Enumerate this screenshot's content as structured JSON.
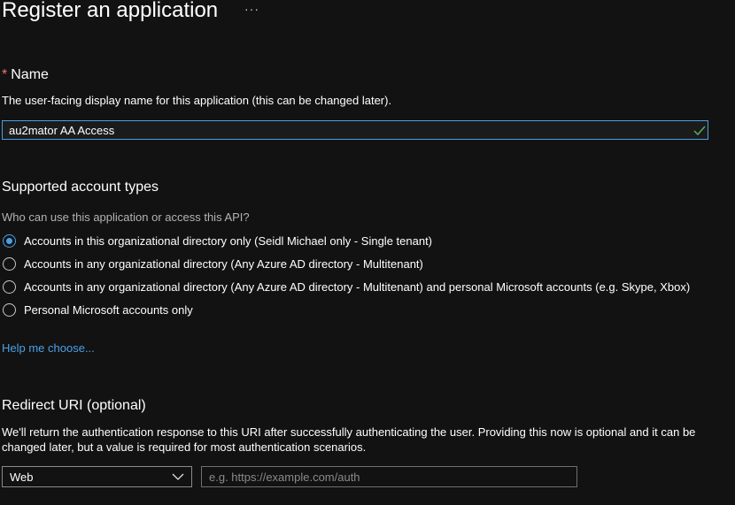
{
  "header": {
    "title": "Register an application",
    "more_glyph": "···"
  },
  "name_section": {
    "required_mark": "*",
    "label": "Name",
    "description": "The user-facing display name for this application (this can be changed later).",
    "value": "au2mator AA Access",
    "valid_icon": "checkmark-icon"
  },
  "account_types": {
    "heading": "Supported account types",
    "question": "Who can use this application or access this API?",
    "options": [
      {
        "label": "Accounts in this organizational directory only (Seidl Michael only - Single tenant)",
        "selected": true
      },
      {
        "label": "Accounts in any organizational directory (Any Azure AD directory - Multitenant)",
        "selected": false
      },
      {
        "label": "Accounts in any organizational directory (Any Azure AD directory - Multitenant) and personal Microsoft accounts (e.g. Skype, Xbox)",
        "selected": false
      },
      {
        "label": "Personal Microsoft accounts only",
        "selected": false
      }
    ],
    "help_link": "Help me choose..."
  },
  "redirect": {
    "heading": "Redirect URI (optional)",
    "description": "We'll return the authentication response to this URI after successfully authenticating the user. Providing this now is optional and it can be changed later, but a value is required for most authentication scenarios.",
    "platform_value": "Web",
    "uri_placeholder": "e.g. https://example.com/auth",
    "uri_value": ""
  },
  "colors": {
    "accent": "#4aa0e6",
    "required": "#f1707b",
    "valid": "#5fb35f",
    "background": "#121212"
  }
}
